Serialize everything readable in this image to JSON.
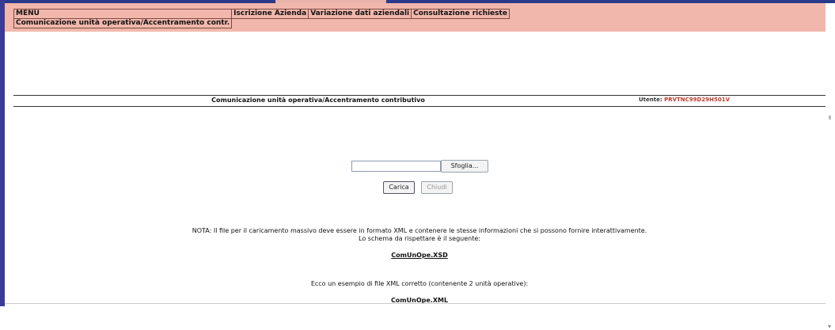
{
  "menu": {
    "header": "MENU",
    "selected_item": "Comunicazione unità operativa/Accentramento contr.",
    "items": [
      "Iscrizione Azienda",
      "Variazione dati aziendali",
      "Consultazione richieste"
    ]
  },
  "page": {
    "title": "Comunicazione unità operativa/Accentramento contributivo",
    "user_label": "Utente:",
    "user_id": "PRVTNC99D29H501V"
  },
  "upload": {
    "file_value": "",
    "browse_label": "Sfoglia...",
    "load_label": "Carica",
    "close_label": "Chiudi"
  },
  "notes": {
    "line1": "NOTA: Il file per il caricamento massivo deve essere in formato XML e contenere le stesse informazioni che si possono fornire interattivamente.",
    "line2": "Lo schema da rispettare è il seguente:",
    "schema_link": "ComUnOpe.XSD",
    "example_text": "Ecco un esempio di file XML corretto (contenente 2 unità operative):",
    "example_link": "ComUnOpe.XML"
  },
  "colors": {
    "menu_band": "#f2b7ac",
    "frame_border": "#3a3a9a",
    "user_id": "#c0392b"
  }
}
